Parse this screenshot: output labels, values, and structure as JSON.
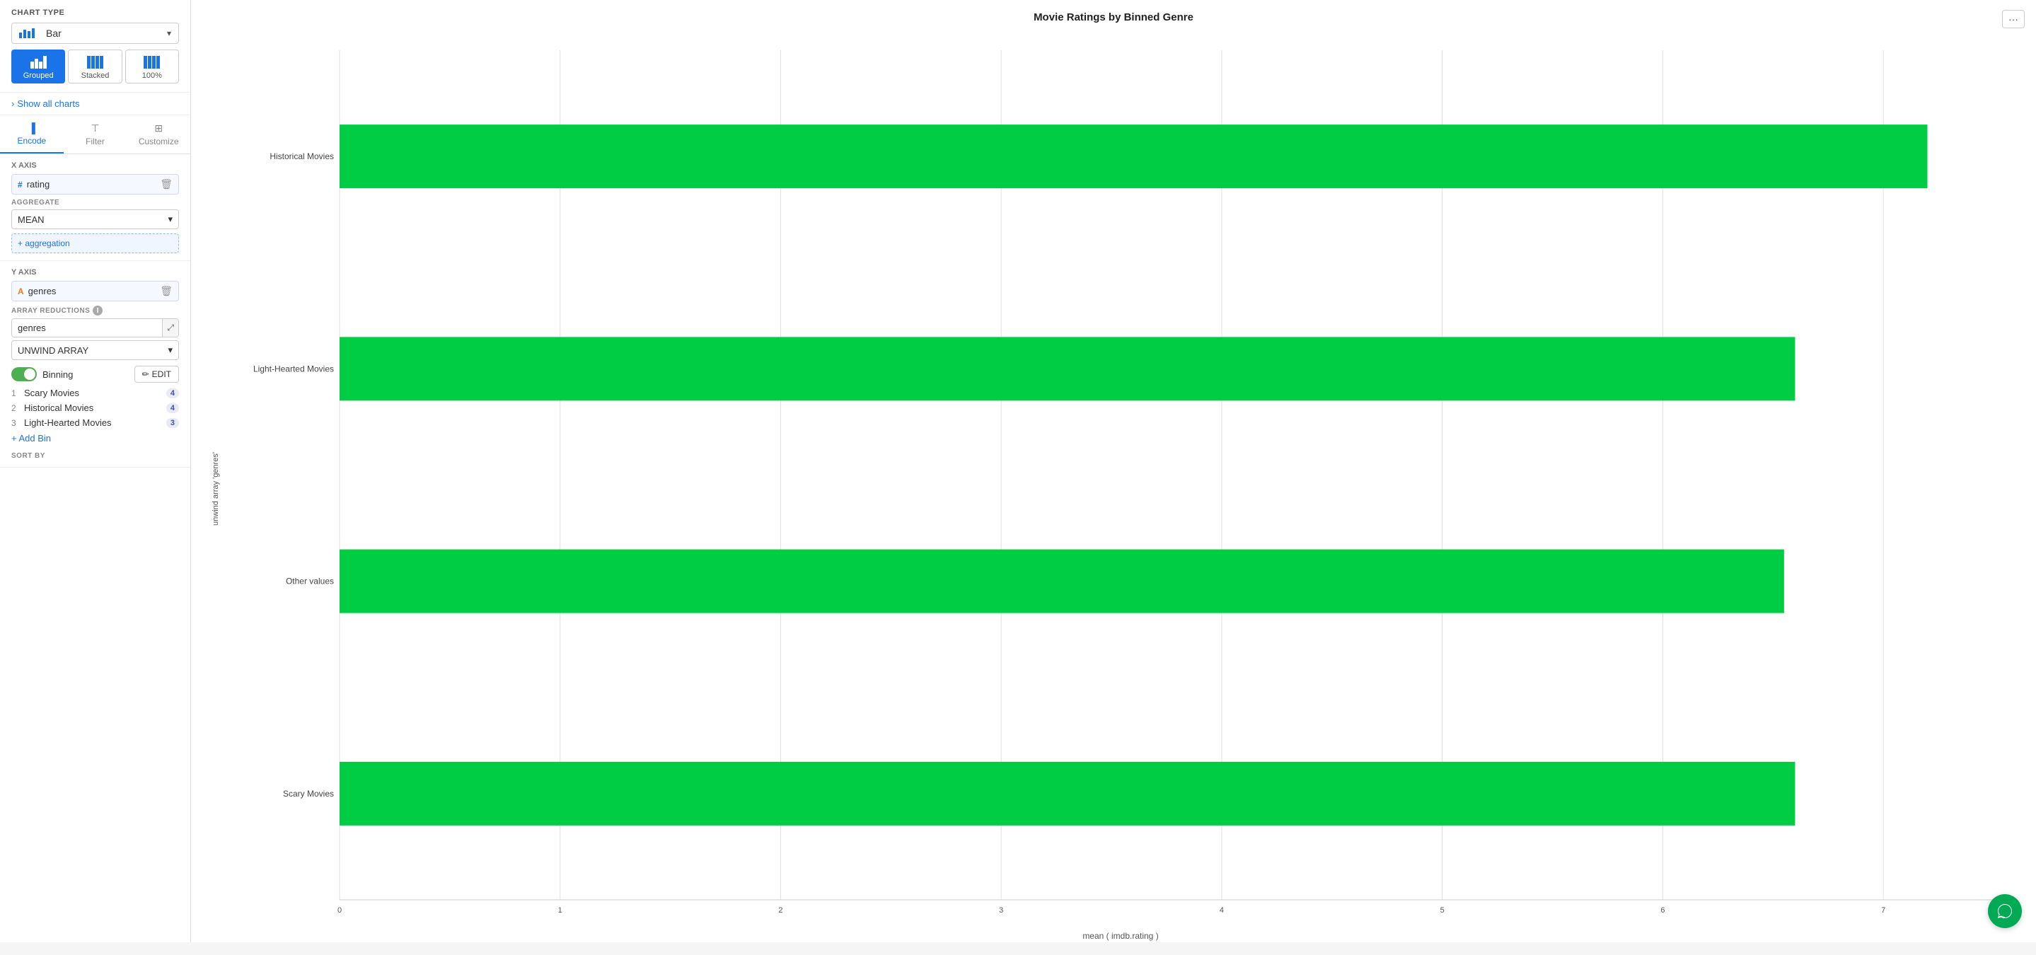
{
  "leftPanel": {
    "chartTypeLabel": "Chart Type",
    "chartTypeValue": "Bar",
    "barTypes": [
      {
        "id": "grouped",
        "label": "Grouped",
        "active": true
      },
      {
        "id": "stacked",
        "label": "Stacked",
        "active": false
      },
      {
        "id": "100pct",
        "label": "100%",
        "active": false
      }
    ],
    "showAllChartsLabel": "Show all charts",
    "tabs": [
      {
        "id": "encode",
        "label": "Encode",
        "active": true
      },
      {
        "id": "filter",
        "label": "Filter",
        "active": false
      },
      {
        "id": "customize",
        "label": "Customize",
        "active": false
      }
    ],
    "xAxis": {
      "label": "X Axis",
      "field": "rating",
      "fieldIcon": "#",
      "aggregateLabel": "AGGREGATE",
      "aggregateValue": "MEAN",
      "addAggregationLabel": "+ aggregation"
    },
    "yAxis": {
      "label": "Y Axis",
      "field": "genres",
      "fieldIcon": "A",
      "arrayReductionsLabel": "ARRAY REDUCTIONS",
      "infoIcon": "i",
      "genresLabel": "genres",
      "unwindValue": "UNWIND ARRAY"
    },
    "binning": {
      "label": "Binning",
      "editLabel": "EDIT",
      "enabled": true,
      "bins": [
        {
          "number": "1",
          "name": "Scary Movies",
          "count": "4"
        },
        {
          "number": "2",
          "name": "Historical Movies",
          "count": "4"
        },
        {
          "number": "3",
          "name": "Light-Hearted Movies",
          "count": "3"
        }
      ],
      "addBinLabel": "+ Add Bin"
    },
    "sortByLabel": "SORT BY"
  },
  "chart": {
    "title": "Movie Ratings by Binned Genre",
    "menuBtn": "···",
    "yAxisLabel": "unwind array 'genres'",
    "xAxisLabel": "mean ( imdb.rating )",
    "categories": [
      {
        "label": "Historical Movies",
        "value": 7.2
      },
      {
        "label": "Light-Hearted Movies",
        "value": 6.6
      },
      {
        "label": "Other values",
        "value": 6.55
      },
      {
        "label": "Scary Movies",
        "value": 6.6
      }
    ],
    "xTicks": [
      0,
      1,
      2,
      3,
      4,
      5,
      6,
      7
    ],
    "maxValue": 7.5,
    "barColor": "#00cc44"
  }
}
